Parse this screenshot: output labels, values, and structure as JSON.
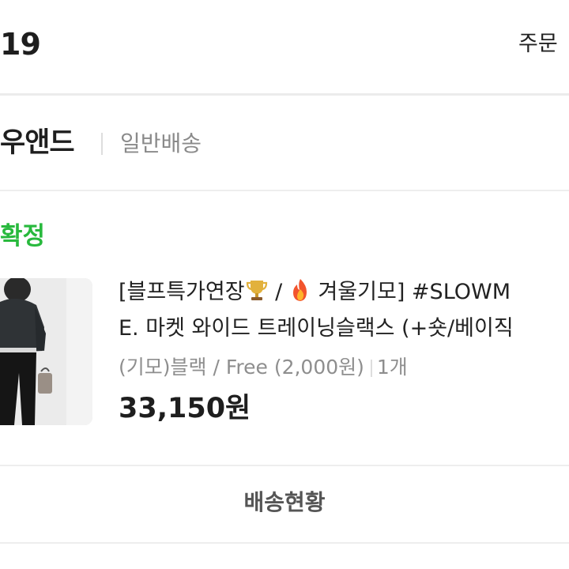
{
  "header": {
    "date": "19",
    "order_link": "주문"
  },
  "seller": {
    "name": "우앤드",
    "shipping_type": "일반배송"
  },
  "order": {
    "status": "확정",
    "product_title_line1_a": "[블프특가연장",
    "product_title_line1_b": "/",
    "product_title_line1_c": " 겨울기모] #SLOWM",
    "product_title_line2": "E. 마켓 와이드 트레이닝슬랙스 (+숏/베이직",
    "option_text": "(기모)블랙 / Free  (2,000원)",
    "quantity": "1개",
    "price": "33,150원"
  },
  "actions": {
    "tracking_label": "배송현황"
  },
  "colors": {
    "status_green": "#28b93d"
  }
}
